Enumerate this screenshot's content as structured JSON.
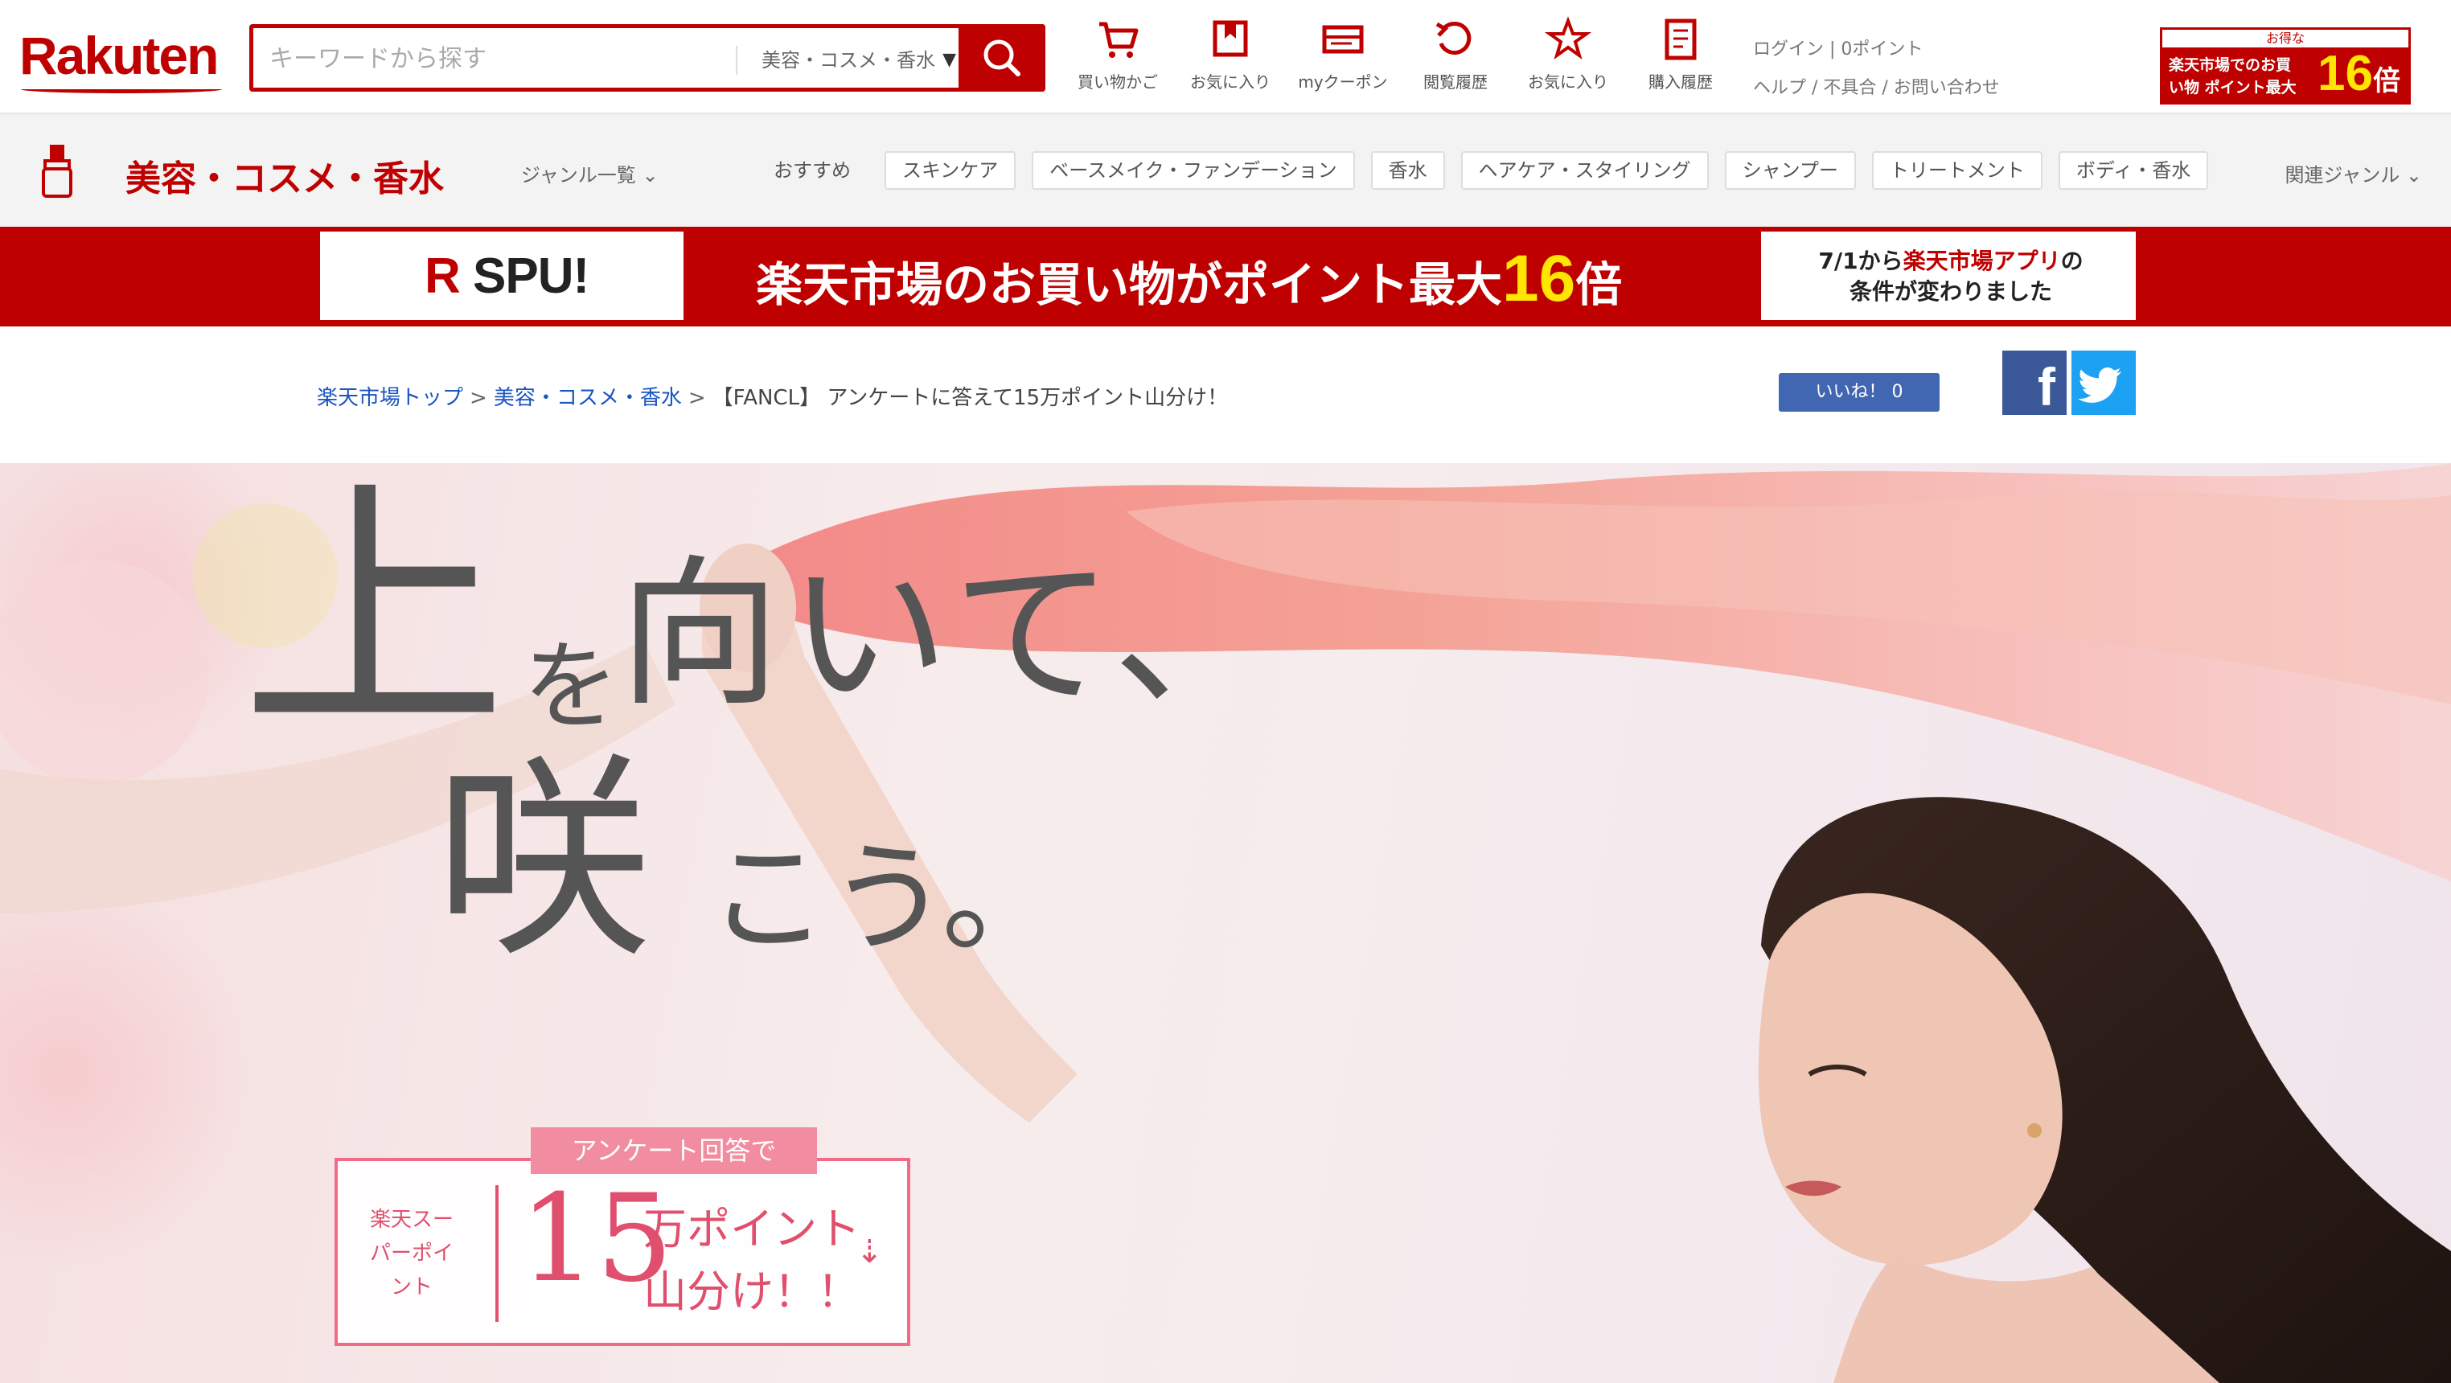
{
  "header": {
    "logo_text": "Rakuten",
    "search": {
      "placeholder": "キーワードから探す",
      "category": "美容・コスメ・香水"
    },
    "nav_icons": [
      {
        "icon": "cart-icon",
        "label": "買い物かご"
      },
      {
        "icon": "bookmark-icon",
        "label": "お気に入り"
      },
      {
        "icon": "coupon-icon",
        "label": "myクーポン"
      },
      {
        "icon": "history-icon",
        "label": "閲覧履歴"
      },
      {
        "icon": "star-icon",
        "label": "お気に入り"
      },
      {
        "icon": "receipt-icon",
        "label": "購入履歴"
      }
    ],
    "account": {
      "points": "ログイン | 0ポイント",
      "help": "ヘルプ / 不具合 / お問い合わせ"
    },
    "spu_badge": {
      "top": "お得な",
      "text": "楽天市場でのお買い物 ポイント最大",
      "multiplier": "16",
      "unit": "倍"
    }
  },
  "genre": {
    "title": "美容・コスメ・香水",
    "select": "ジャンル一覧",
    "tags": [
      "おすすめ",
      "スキンケア",
      "ベースメイク・ファンデーション",
      "香水",
      "ヘアケア・スタイリング",
      "シャンプー",
      "トリートメント",
      "ボディ・香水"
    ],
    "right": "関連ジャンル"
  },
  "spu_banner": {
    "logo_r": "R",
    "logo_text": "SPU!",
    "main_text": "楽天市場のお買い物がポイント最大",
    "multiplier": "16",
    "unit": "倍",
    "right_line1_a": "7/1から",
    "right_line1_b": "楽天市場アプリ",
    "right_line1_c": "の",
    "right_line2": "条件が変わりました"
  },
  "breadcrumb": {
    "items": [
      "楽天市場トップ",
      "美容・コスメ・香水"
    ],
    "current": "【FANCL】 アンケートに答えて15万ポイント山分け！",
    "like_label": "いいね！ 0"
  },
  "social": {
    "facebook": "f",
    "twitter": "twitter-icon"
  },
  "hero": {
    "catch_1": "上",
    "catch_2": "を",
    "catch_3": "向いて、",
    "catch_4": "咲",
    "catch_5": "こう。",
    "campaign_label": "アンケート回答で",
    "campaign_small": "楽天スーパーポイント",
    "campaign_number": "15",
    "campaign_text1": "万ポイント",
    "campaign_text2": "山分け！！",
    "campaign_arrow": "⇣"
  },
  "colors": {
    "brand": "#bf0000",
    "highlight": "#ffe600",
    "campaign_pink": "#e0506e"
  }
}
